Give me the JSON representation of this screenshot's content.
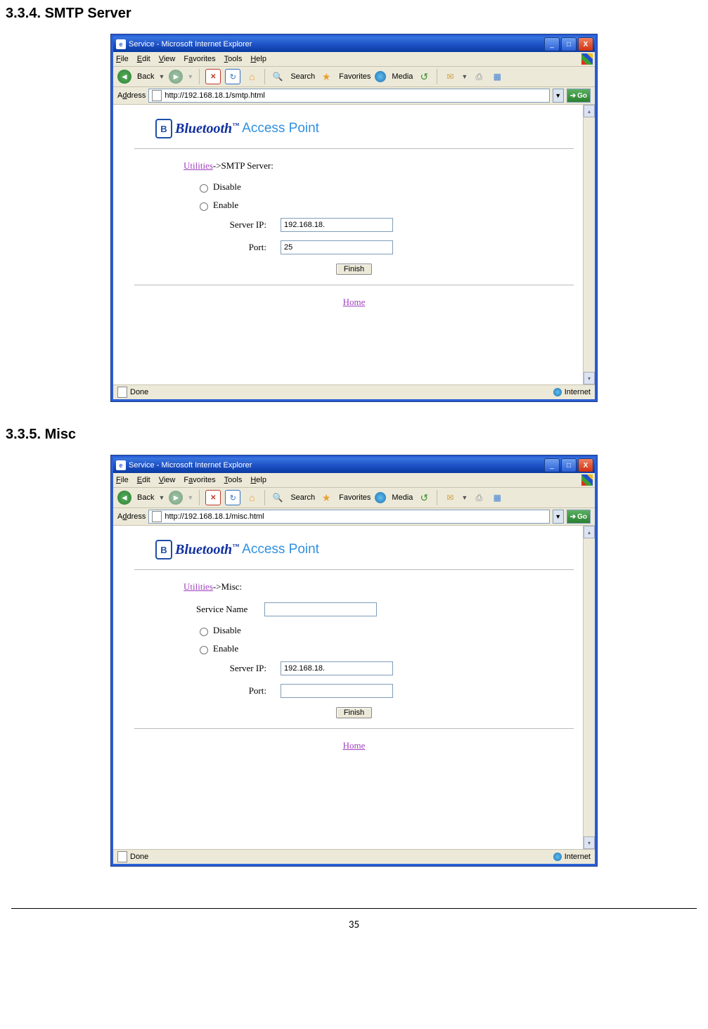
{
  "sections": {
    "smtp": "3.3.4. SMTP Server",
    "misc": "3.3.5. Misc"
  },
  "window": {
    "title": "Service - Microsoft Internet Explorer",
    "min": "_",
    "max": "□",
    "close": "X"
  },
  "menu": {
    "file": "File",
    "edit": "Edit",
    "view": "View",
    "favorites": "Favorites",
    "tools": "Tools",
    "help": "Help"
  },
  "toolbar": {
    "back": "Back",
    "search": "Search",
    "favorites": "Favorites",
    "media": "Media"
  },
  "address": {
    "label": "Address",
    "smtp_url": "http://192.168.18.1/smtp.html",
    "misc_url": "http://192.168.18.1/misc.html",
    "go": "Go"
  },
  "logo": {
    "mark": "B",
    "text1": "Bluetooth",
    "tm": "™",
    "text2": "Access Point"
  },
  "smtp_page": {
    "breadcrumb_link": "Utilities",
    "breadcrumb_tail": "->SMTP Server:",
    "disable": "Disable",
    "enable": "Enable",
    "server_ip_label": "Server IP:",
    "server_ip_value": "192.168.18.",
    "port_label": "Port:",
    "port_value": "25",
    "finish": "Finish",
    "home": "Home"
  },
  "misc_page": {
    "breadcrumb_link": "Utilities",
    "breadcrumb_tail": "->Misc:",
    "service_name_label": "Service Name",
    "service_name_value": "",
    "disable": "Disable",
    "enable": "Enable",
    "server_ip_label": "Server IP:",
    "server_ip_value": "192.168.18.",
    "port_label": "Port:",
    "port_value": "",
    "finish": "Finish",
    "home": "Home"
  },
  "status": {
    "done": "Done",
    "zone": "Internet"
  },
  "page_number": "35"
}
